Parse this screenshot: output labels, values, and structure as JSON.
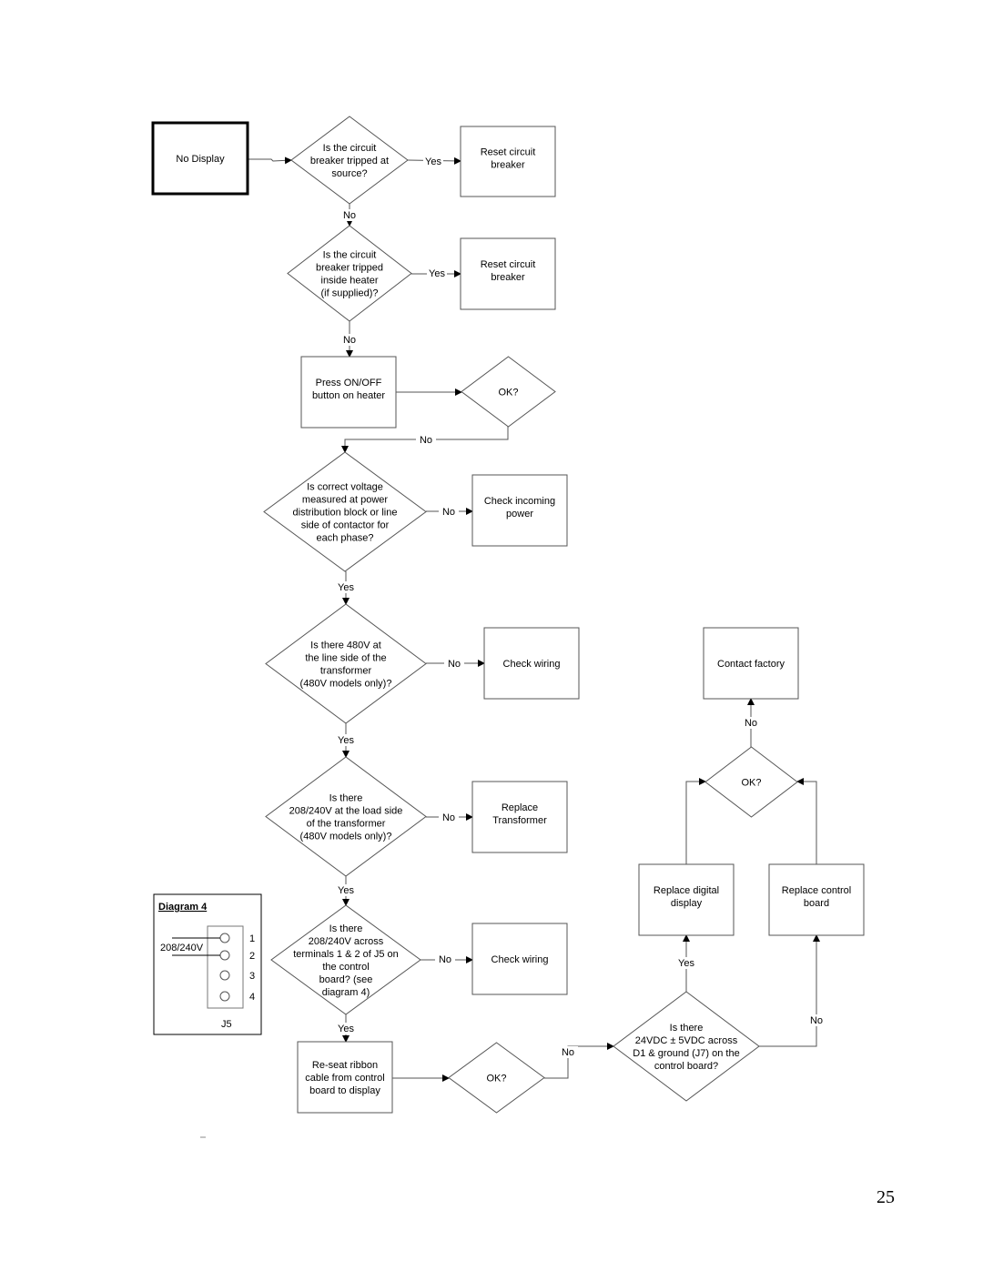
{
  "nodes": {
    "start": [
      "No Display"
    ],
    "d1": [
      "Is the circuit",
      "breaker tripped at",
      "source?"
    ],
    "r1": [
      "Reset circuit",
      "breaker"
    ],
    "d2": [
      "Is the circuit",
      "breaker tripped",
      "inside heater",
      "(if supplied)?"
    ],
    "r2": [
      "Reset circuit",
      "breaker"
    ],
    "r3": [
      "Press ON/OFF",
      "button on heater"
    ],
    "d3": [
      "OK?"
    ],
    "d4": [
      "Is correct voltage",
      "measured at power",
      "distribution block or line",
      "side of contactor for",
      "each phase?"
    ],
    "r4": [
      "Check incoming",
      "power"
    ],
    "d5": [
      "Is there 480V at",
      "the line side of the",
      "transformer",
      "(480V models only)?"
    ],
    "r5": [
      "Check wiring"
    ],
    "r6": [
      "Contact factory"
    ],
    "d6": [
      "OK?"
    ],
    "d7": [
      "Is there",
      "208/240V at the load side",
      "of the transformer",
      "(480V models only)?"
    ],
    "r7": [
      "Replace",
      "Transformer"
    ],
    "r8": [
      "Replace digital",
      "display"
    ],
    "r9": [
      "Replace control",
      "board"
    ],
    "d8": [
      "Is there",
      "208/240V across",
      "terminals 1 & 2 of J5 on",
      "the control",
      "board? (see",
      "diagram 4)"
    ],
    "r10": [
      "Check wiring"
    ],
    "r11": [
      "Re-seat ribbon",
      "cable from control",
      "board to display"
    ],
    "d9": [
      "OK?"
    ],
    "d10": [
      "Is there",
      "24VDC ± 5VDC across",
      "D1 & ground (J7) on the",
      "control board?"
    ]
  },
  "edge_labels": [
    "Yes",
    "No",
    "Yes",
    "No",
    "No",
    "No",
    "Yes",
    "No",
    "Yes",
    "No",
    "Yes",
    "No",
    "Yes",
    "No",
    "No",
    "Yes",
    "No"
  ],
  "diagram4": {
    "title": "Diagram 4",
    "voltage": "208/240V",
    "pins": [
      "1",
      "2",
      "3",
      "4"
    ],
    "connector": "J5"
  },
  "page_number": "25"
}
